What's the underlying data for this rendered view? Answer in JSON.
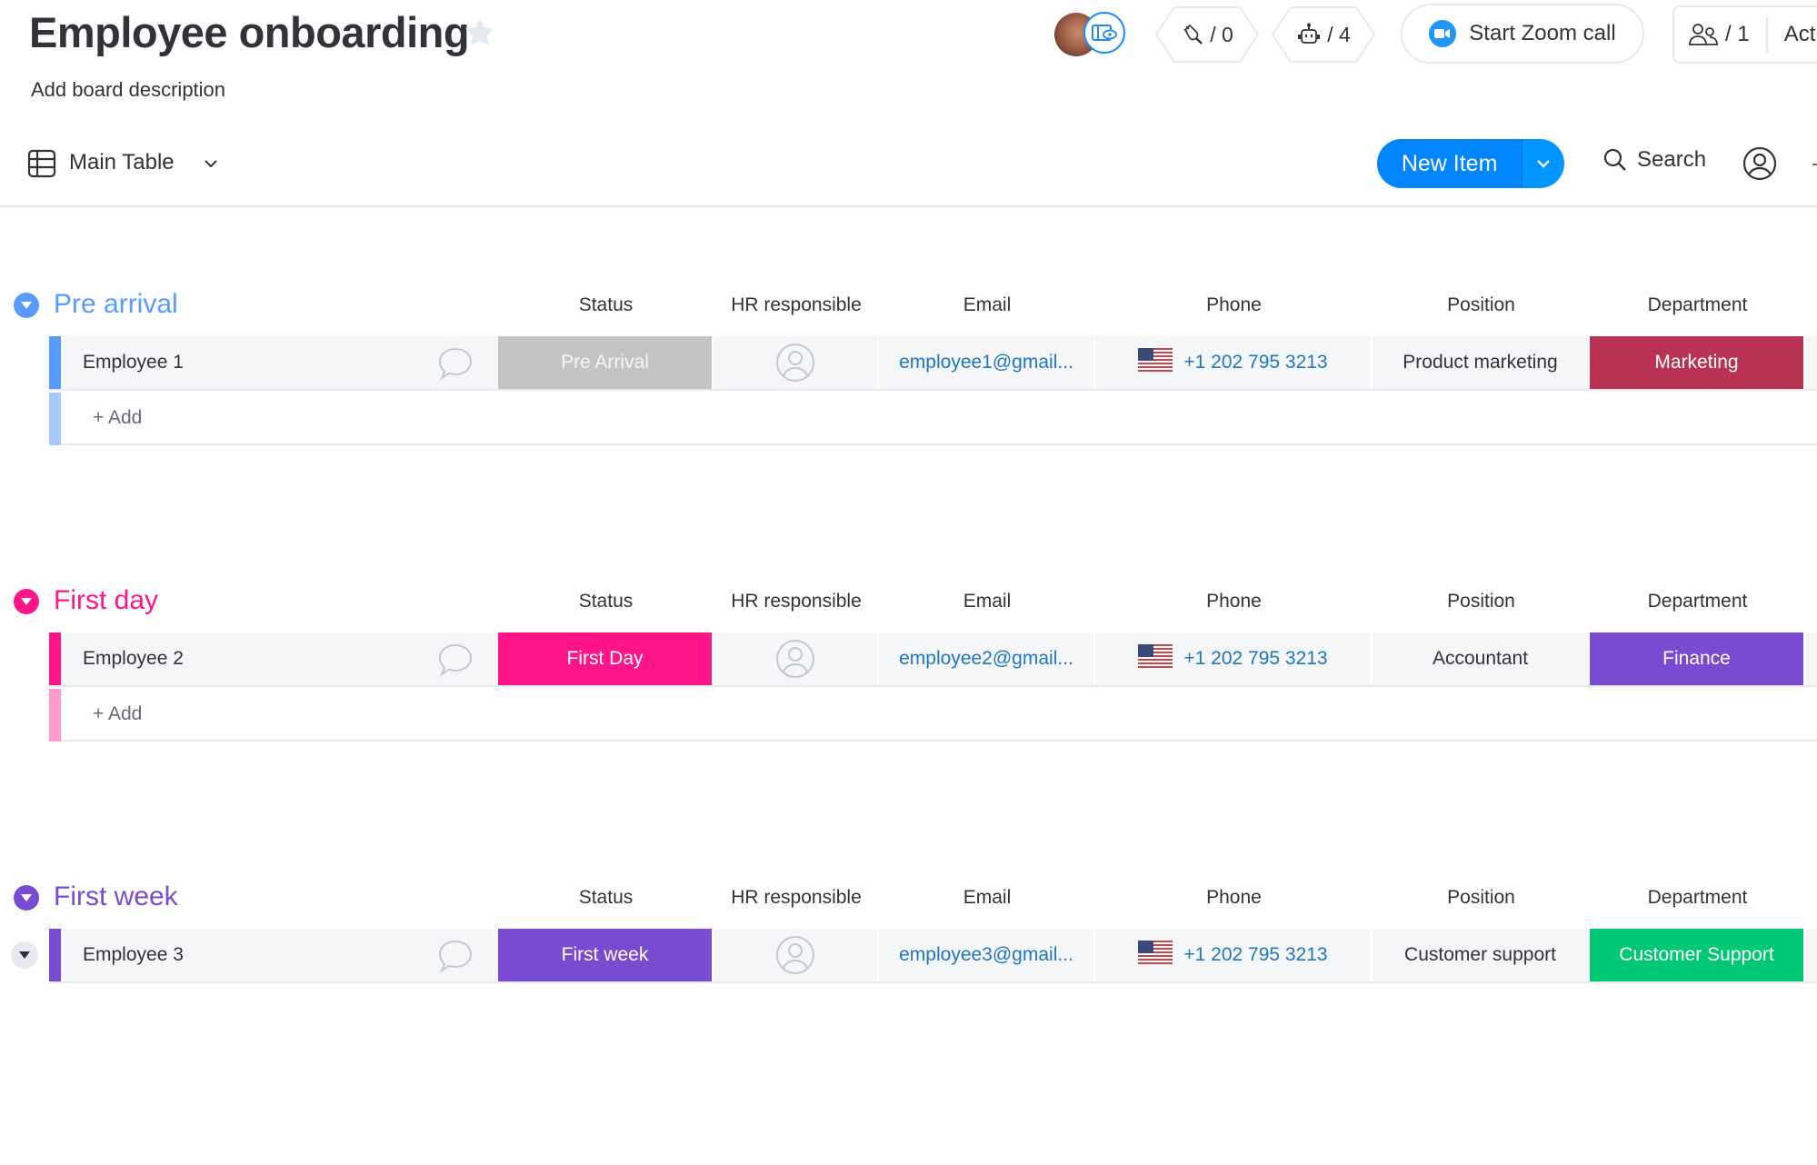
{
  "board": {
    "title": "Employee onboarding",
    "description": "Add board description",
    "favorite_icon": "star-icon"
  },
  "header": {
    "integrations_count": "/ 0",
    "automations_count": "/ 4",
    "zoom_label": "Start Zoom call",
    "members_count": "/ 1",
    "activity_label": "Act"
  },
  "toolbar": {
    "view_label": "Main Table",
    "new_item_label": "New Item",
    "search_label": "Search"
  },
  "columns": [
    "Status",
    "HR responsible",
    "Email",
    "Phone",
    "Position",
    "Department"
  ],
  "colors": {
    "blue_group": "#579bfc",
    "pink_group": "#ff158a",
    "purple_group": "#784bd1",
    "pre_arrival": "#c4c4c4",
    "first_day": "#ff158a",
    "first_week": "#784bd1",
    "marketing": "#bb3354",
    "finance": "#784bd1",
    "customer_support": "#00c875",
    "link": "#1f76c2",
    "primary": "#0085ff"
  },
  "groups": [
    {
      "title": "Pre arrival",
      "add_label": "+ Add",
      "items": [
        {
          "name": "Employee 1",
          "status": "Pre Arrival",
          "email": "employee1@gmail...",
          "phone": "+1 202 795 3213",
          "position": "Product marketing",
          "department": "Marketing"
        }
      ]
    },
    {
      "title": "First day",
      "add_label": "+ Add",
      "items": [
        {
          "name": "Employee 2",
          "status": "First Day",
          "email": "employee2@gmail...",
          "phone": "+1 202 795 3213",
          "position": "Accountant",
          "department": "Finance"
        }
      ]
    },
    {
      "title": "First week",
      "items": [
        {
          "name": "Employee 3",
          "status": "First week",
          "email": "employee3@gmail...",
          "phone": "+1 202 795 3213",
          "position": "Customer support",
          "department": "Customer Support"
        }
      ]
    }
  ]
}
